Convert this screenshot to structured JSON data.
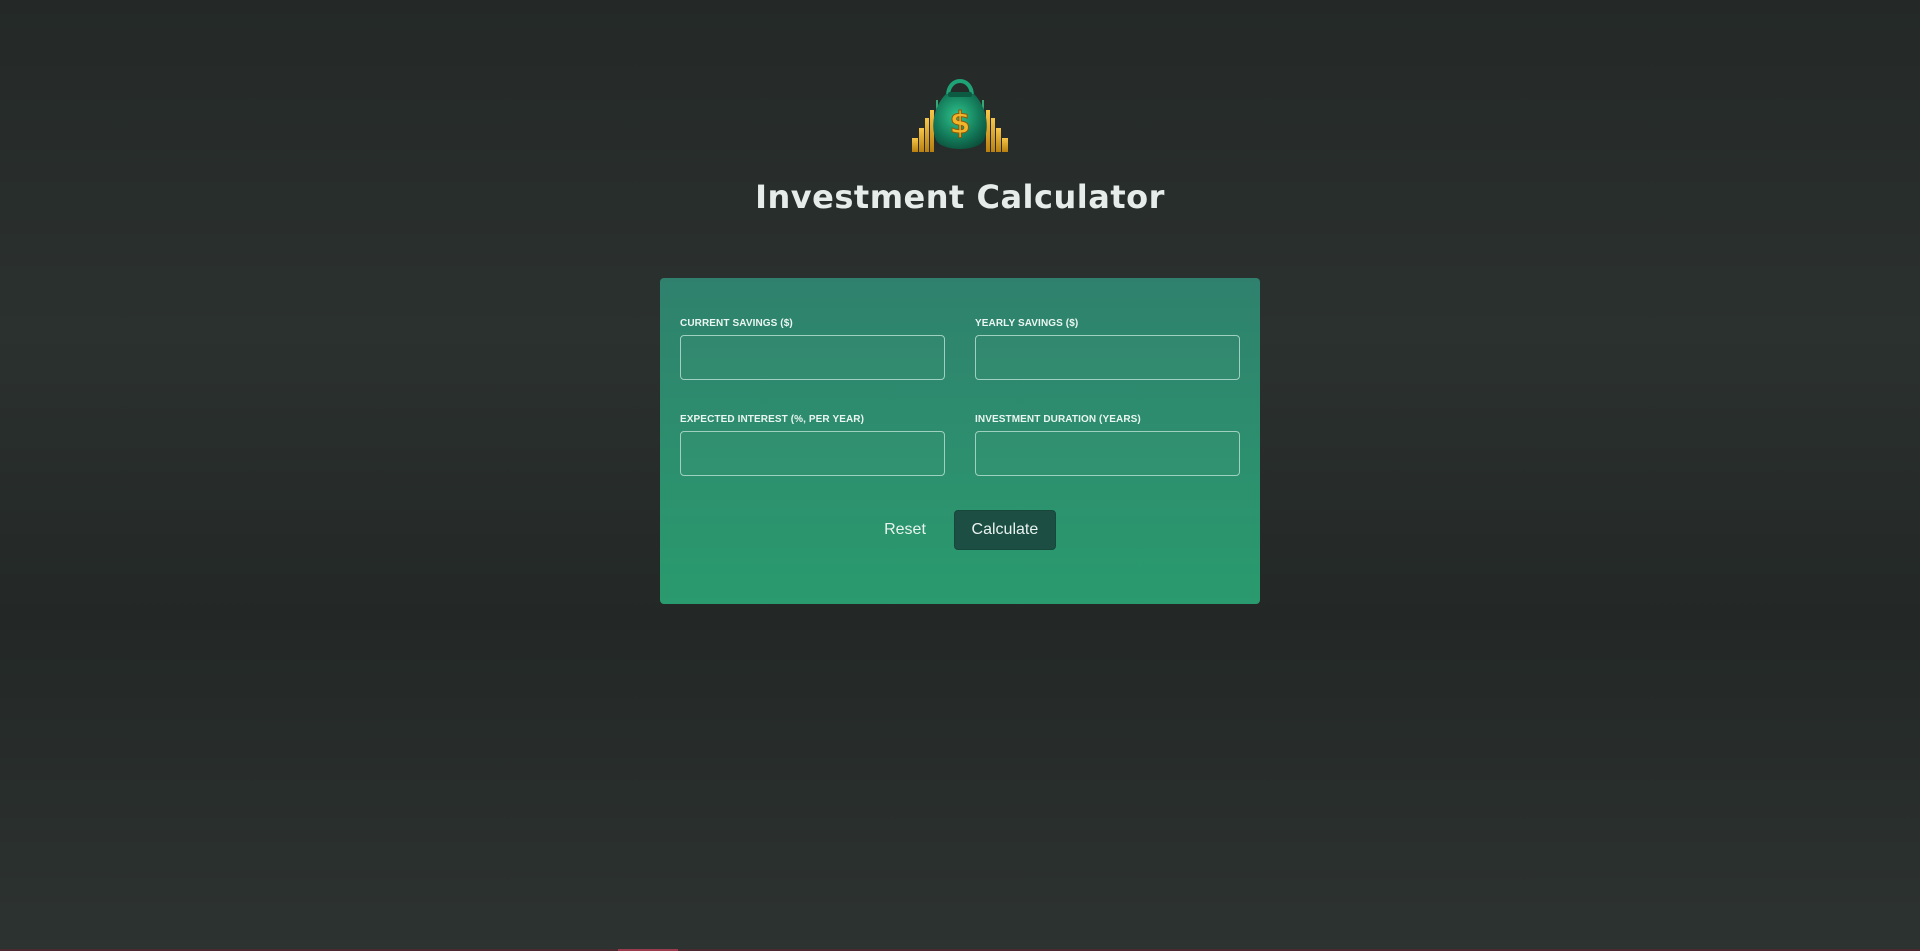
{
  "header": {
    "logo_icon": "money-bag-icon",
    "title": "Investment Calculator"
  },
  "form": {
    "fields": [
      {
        "label": "CURRENT SAVINGS ($)",
        "value": "",
        "placeholder": ""
      },
      {
        "label": "YEARLY SAVINGS ($)",
        "value": "",
        "placeholder": ""
      },
      {
        "label": "EXPECTED INTEREST (%, PER YEAR)",
        "value": "",
        "placeholder": ""
      },
      {
        "label": "INVESTMENT DURATION (YEARS)",
        "value": "",
        "placeholder": ""
      }
    ],
    "reset_label": "Reset",
    "calculate_label": "Calculate"
  },
  "colors": {
    "background": "#262b29",
    "card_top": "#2f816d",
    "card_bottom": "#2a9b6e",
    "button_dark": "#1d4e43",
    "gold": "#e0a81c"
  }
}
